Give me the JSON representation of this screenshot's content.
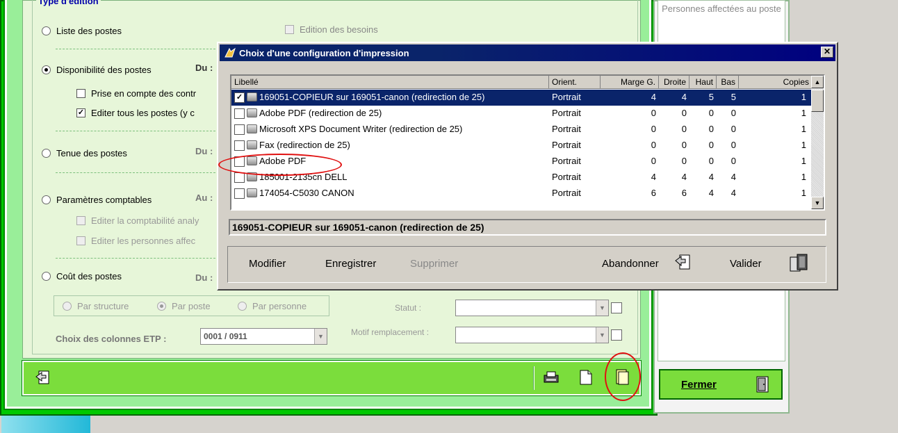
{
  "background_form": {
    "group_title": "Type d'édition",
    "options": {
      "liste": "Liste des postes",
      "edition_besoins": "Edition des besoins",
      "disponibilite": "Disponibilité des postes",
      "prise_en_compte": "Prise en compte des contr",
      "editer_tous": "Editer tous les postes (y c",
      "tenue": "Tenue des postes",
      "parametres": "Paramètres comptables",
      "editer_compta": "Editer la comptabilité analy",
      "editer_personnes": "Editer les personnes affec",
      "cout": "Coût des postes"
    },
    "du_label": "Du :",
    "au_label": "Au :",
    "sub_options": {
      "par_structure": "Par structure",
      "par_poste": "Par poste",
      "par_personne": "Par personne"
    },
    "statut_label": "Statut :",
    "motif_label": "Motif remplacement :",
    "etp_label": "Choix des colonnes ETP :",
    "etp_value": "0001 / 0911"
  },
  "right_panel": {
    "title": "Personnes affectées au poste",
    "close_label": "Fermer"
  },
  "dialog": {
    "title": "Choix d'une configuration d'impression",
    "close_glyph": "✕",
    "columns": [
      "Libellé",
      "Orient.",
      "Marge G.",
      "Droite",
      "Haut",
      "Bas",
      "Copies"
    ],
    "rows": [
      {
        "checked": true,
        "label": "169051-COPIEUR sur 169051-canon (redirection de 25)",
        "orient": "Portrait",
        "marge": "4",
        "droite": "4",
        "haut": "5",
        "bas": "5",
        "copies": "1"
      },
      {
        "checked": false,
        "label": "Adobe PDF (redirection de 25)",
        "orient": "Portrait",
        "marge": "0",
        "droite": "0",
        "haut": "0",
        "bas": "0",
        "copies": "1"
      },
      {
        "checked": false,
        "label": "Microsoft XPS Document Writer (redirection de 25)",
        "orient": "Portrait",
        "marge": "0",
        "droite": "0",
        "haut": "0",
        "bas": "0",
        "copies": "1"
      },
      {
        "checked": false,
        "label": "Fax (redirection de 25)",
        "orient": "Portrait",
        "marge": "0",
        "droite": "0",
        "haut": "0",
        "bas": "0",
        "copies": "1"
      },
      {
        "checked": false,
        "label": "Adobe PDF",
        "orient": "Portrait",
        "marge": "0",
        "droite": "0",
        "haut": "0",
        "bas": "0",
        "copies": "1"
      },
      {
        "checked": false,
        "label": "185001-2135cn DELL",
        "orient": "Portrait",
        "marge": "4",
        "droite": "4",
        "haut": "4",
        "bas": "4",
        "copies": "1"
      },
      {
        "checked": false,
        "label": "174054-C5030 CANON",
        "orient": "Portrait",
        "marge": "6",
        "droite": "6",
        "haut": "4",
        "bas": "4",
        "copies": "1"
      }
    ],
    "selected_label": "169051-COPIEUR sur 169051-canon (redirection de 25)",
    "buttons": {
      "modifier": "Modifier",
      "enregistrer": "Enregistrer",
      "supprimer": "Supprimer",
      "abandonner": "Abandonner",
      "valider": "Valider"
    }
  },
  "colors": {
    "dialog_title_bg": "#0a246a",
    "green_frame": "#00c800",
    "form_bg": "#e7f6d9",
    "annotation_red": "#e01010"
  }
}
